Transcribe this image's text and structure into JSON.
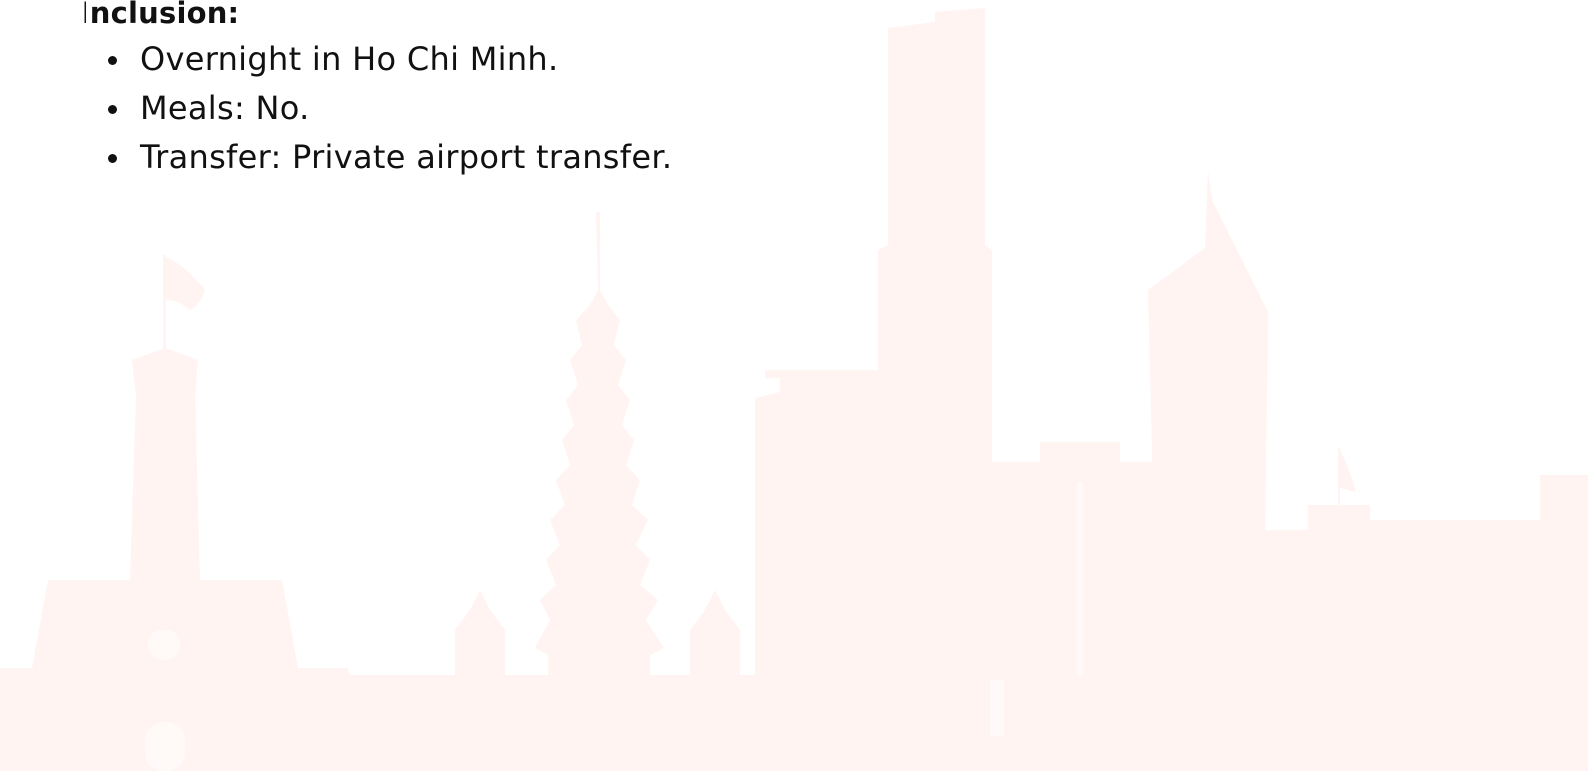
{
  "section": {
    "heading_first_letter": "I",
    "heading_rest": "nclusion:",
    "items": [
      "Overnight in Ho Chi Minh.",
      "Meals: No.",
      "Transfer: Private airport transfer."
    ]
  },
  "colors": {
    "text": "#111111",
    "skyline_watermark": "#FFF4F1",
    "background": "#FFFFFF"
  },
  "background_art": {
    "icon": "ho-chi-minh-city-skyline-watermark"
  }
}
